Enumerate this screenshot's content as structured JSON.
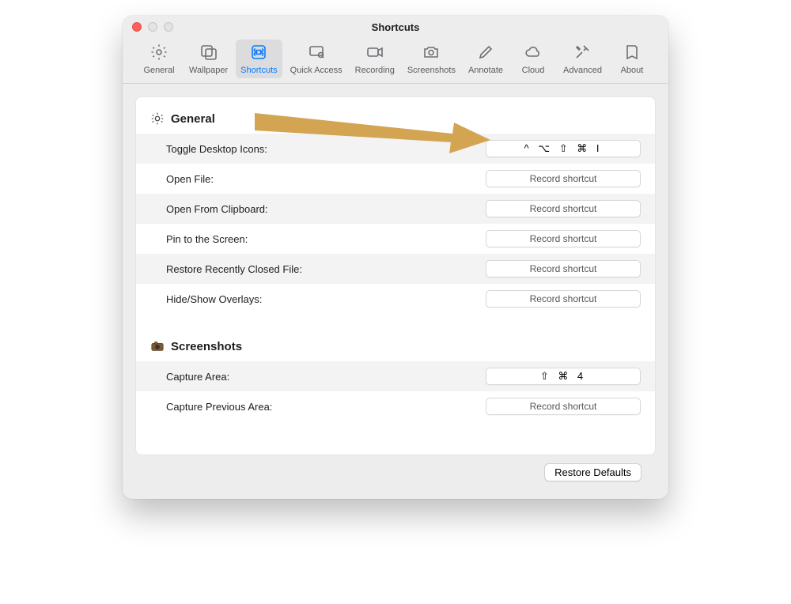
{
  "window": {
    "title": "Shortcuts"
  },
  "toolbar": {
    "items": [
      {
        "label": "General",
        "icon": "gear"
      },
      {
        "label": "Wallpaper",
        "icon": "wallpaper"
      },
      {
        "label": "Shortcuts",
        "icon": "command",
        "selected": true
      },
      {
        "label": "Quick Access",
        "icon": "quickaccess"
      },
      {
        "label": "Recording",
        "icon": "recording"
      },
      {
        "label": "Screenshots",
        "icon": "camera"
      },
      {
        "label": "Annotate",
        "icon": "pencil"
      },
      {
        "label": "Cloud",
        "icon": "cloud"
      },
      {
        "label": "Advanced",
        "icon": "tools"
      },
      {
        "label": "About",
        "icon": "about"
      }
    ]
  },
  "sections": [
    {
      "title": "General",
      "icon": "gear-small",
      "rows": [
        {
          "label": "Toggle Desktop Icons:",
          "shortcut": "^ ⌥ ⇧ ⌘ I"
        },
        {
          "label": "Open File:",
          "shortcut": "Record shortcut"
        },
        {
          "label": "Open From Clipboard:",
          "shortcut": "Record shortcut"
        },
        {
          "label": "Pin to the Screen:",
          "shortcut": "Record shortcut"
        },
        {
          "label": "Restore Recently Closed File:",
          "shortcut": "Record shortcut"
        },
        {
          "label": "Hide/Show Overlays:",
          "shortcut": "Record shortcut"
        }
      ]
    },
    {
      "title": "Screenshots",
      "icon": "screenshots-small",
      "rows": [
        {
          "label": "Capture Area:",
          "shortcut": "⇧ ⌘ 4"
        },
        {
          "label": "Capture Previous Area:",
          "shortcut": "Record shortcut"
        }
      ]
    }
  ],
  "footer": {
    "restore": "Restore Defaults"
  },
  "placeholders": {
    "record": "Record shortcut"
  }
}
